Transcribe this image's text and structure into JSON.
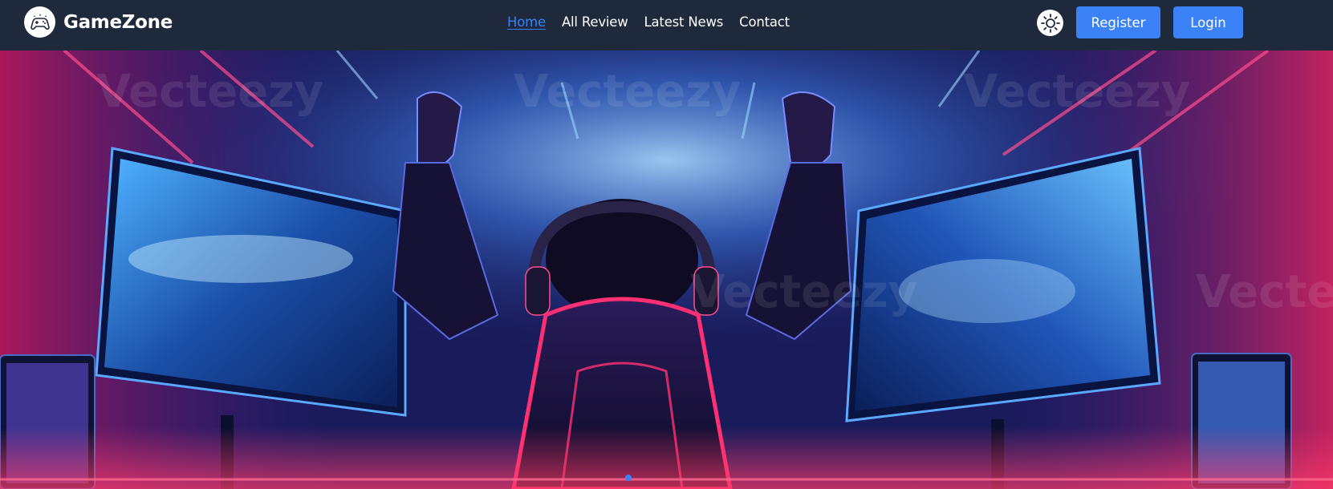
{
  "brand": {
    "name": "GameZone",
    "logo_icon": "gamepad-icon"
  },
  "nav": {
    "items": [
      {
        "label": "Home",
        "active": true
      },
      {
        "label": "All Review",
        "active": false
      },
      {
        "label": "Latest News",
        "active": false
      },
      {
        "label": "Contact",
        "active": false
      }
    ]
  },
  "header_actions": {
    "theme_icon": "sun-icon",
    "register_label": "Register",
    "login_label": "Login"
  },
  "hero": {
    "watermark": "Vecteezy",
    "slides": 1,
    "active_slide": 1
  },
  "colors": {
    "navbar_bg": "#1e293b",
    "accent": "#3b82f6",
    "text": "#ffffff"
  }
}
